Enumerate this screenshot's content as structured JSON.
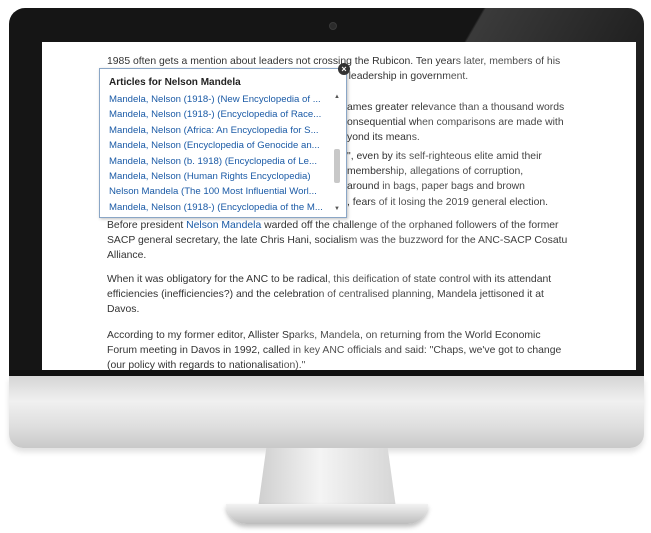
{
  "article": {
    "p1": [
      "1985 often gets a mention about leaders not crossing the Rubicon. Ten years later, members of his",
      "r its leadership in government."
    ],
    "p2": [
      "ames greater relevance than a thousand words",
      "onsequential when comparisons are made with",
      "yond its means."
    ],
    "p3": [
      "\", even by its self-righteous elite amid their",
      "membership, allegations of corruption,",
      "around in bags, paper bags and brown",
      ", fears of it losing the 2019 general election."
    ],
    "p4_before": "Before president ",
    "p4_link": "Nelson Mandela",
    "p4_after": " warded off the challenge of the orphaned followers of the former",
    "p4_lines": [
      "SACP general secretary, the late Chris Hani, socialism was the buzzword for the ANC-SACP Cosatu",
      "Alliance."
    ],
    "p5": [
      "When it was obligatory for the ANC to be radical, this deification of state control with its attendant",
      "efficiencies (inefficiencies?) and the celebration of centralised planning, Mandela jettisoned it at",
      "Davos."
    ],
    "p6": [
      "According to my former editor, Allister Sparks, Mandela, on returning from the World Economic",
      "Forum meeting in Davos in 1992, called in key ANC officials and said: \"Chaps, we've got to change",
      "(our policy with regards to nationalisation).\""
    ]
  },
  "popup": {
    "title": "Articles for Nelson Mandela",
    "close_label": "×",
    "items": [
      "Mandela, Nelson (1918-) (New Encyclopedia of ...",
      "Mandela, Nelson (1918-) (Encyclopedia of Race...",
      "Mandela, Nelson (Africa: An Encyclopedia for S...",
      "Mandela, Nelson (Encyclopedia of Genocide an...",
      "Mandela, Nelson (b. 1918) (Encyclopedia of Le...",
      "Mandela, Nelson (Human Rights Encyclopedia)",
      "Nelson Mandela (The 100 Most Influential Worl...",
      "Mandela, Nelson (1918-) (Encyclopedia of the M..."
    ],
    "scroll_up": "▲",
    "scroll_down": "▼"
  },
  "colors": {
    "link": "#1a5aa6",
    "text": "#333333",
    "popup_border": "#8aa6c6",
    "bezel": "#151515"
  }
}
